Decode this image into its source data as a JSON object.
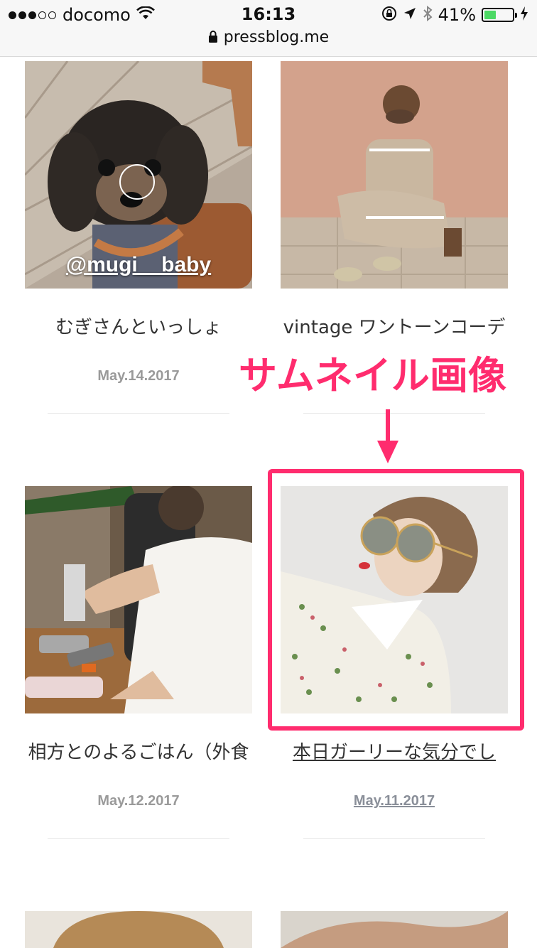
{
  "status_bar": {
    "carrier": "docomo",
    "time": "16:13",
    "battery_percent": "41%",
    "battery_level": 0.41,
    "signal_dots": [
      true,
      true,
      true,
      false,
      false
    ]
  },
  "browser": {
    "url": "pressblog.me"
  },
  "posts": [
    {
      "title": "むぎさんといっしょ",
      "date": "May.14.2017",
      "overlay": "@mugi__baby"
    },
    {
      "title": "vintage ワントーンコーデ",
      "date": ""
    },
    {
      "title": "相方とのよるごはん（外食",
      "date": "May.12.2017"
    },
    {
      "title": "本日ガーリーな気分でし",
      "date": "May.11.2017"
    }
  ],
  "annotation": {
    "label": "サムネイル画像",
    "color": "#ff2c6e"
  },
  "colors": {
    "accent": "#ff2c6e",
    "battery_fill": "#4cd964",
    "date_gray": "#9a9a9a"
  }
}
